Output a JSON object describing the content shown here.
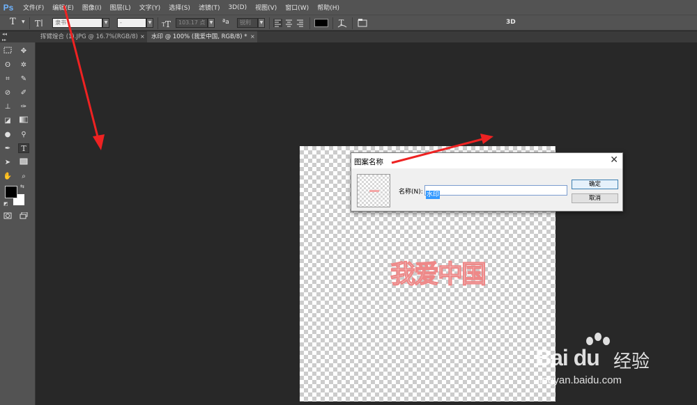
{
  "app": {
    "logo": "Ps"
  },
  "menu": [
    "文件(F)",
    "编辑(E)",
    "图像(I)",
    "图层(L)",
    "文字(Y)",
    "选择(S)",
    "滤镜(T)",
    "3D(D)",
    "视图(V)",
    "窗口(W)",
    "帮助(H)"
  ],
  "options_bar": {
    "tool_icon": "T",
    "font_family": "隶书",
    "font_style": "-",
    "font_size": "103.17 点",
    "aa_label": "ªa",
    "aa_mode": "锐利",
    "threeD_label": "3D",
    "text_color": "#000000"
  },
  "tabs": [
    {
      "label": "挥臂煌合 (1).JPG @ 16.7%(RGB/8)",
      "close": "×"
    },
    {
      "label": "水印 @ 100% (我爱中国, RGB/8) *",
      "close": "×"
    }
  ],
  "toolbox": {
    "foreground_color": "#000000",
    "background_color": "#ffffff",
    "tools": [
      "marquee-icon",
      "move-icon",
      "lasso-icon",
      "magic-wand-icon",
      "crop-icon",
      "eyedropper-icon",
      "healing-brush-icon",
      "brush-icon",
      "clone-stamp-icon",
      "history-brush-icon",
      "eraser-icon",
      "gradient-icon",
      "blur-icon",
      "dodge-icon",
      "pen-icon",
      "type-icon",
      "path-selection-icon",
      "rectangle-icon",
      "hand-icon",
      "zoom-icon"
    ]
  },
  "canvas": {
    "watermark_text": "我爱中国"
  },
  "dialog": {
    "title": "图案名称",
    "close": "✕",
    "name_label": "名称(N):",
    "name_value": "水印",
    "ok_label": "确定",
    "cancel_label": "取消"
  },
  "brand": {
    "name": "Bai du",
    "cn": "经验",
    "url": "jingyan.baidu.com"
  },
  "colors": {
    "accent": "#3399ff",
    "arrow": "#ee2222"
  }
}
